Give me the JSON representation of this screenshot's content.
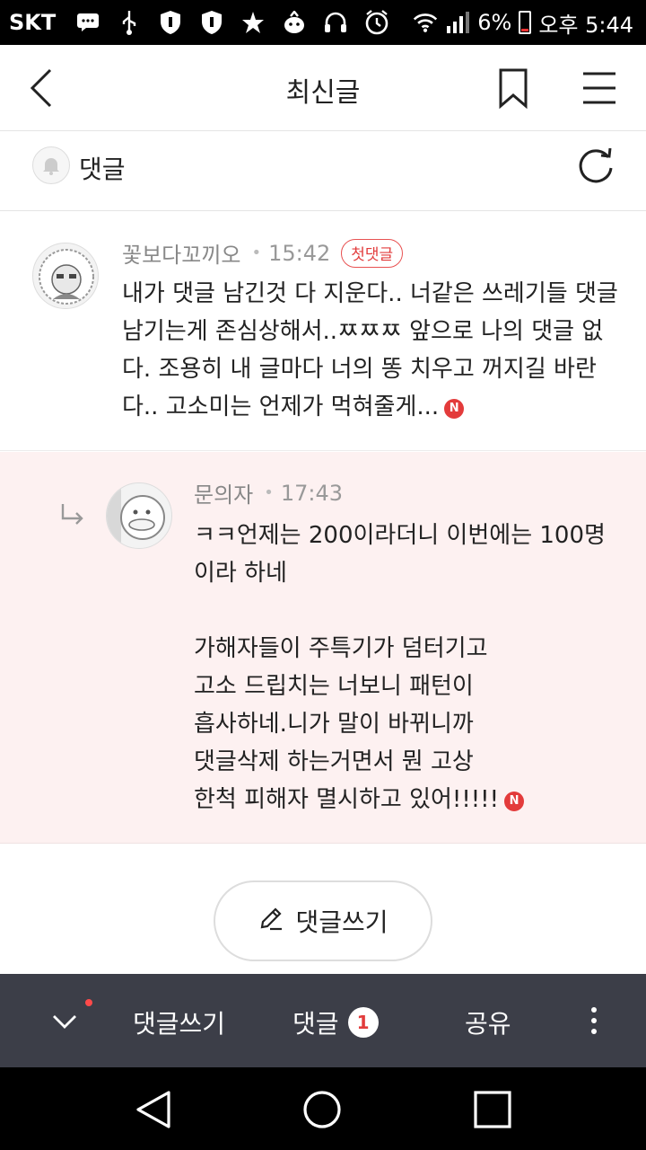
{
  "status_bar": {
    "carrier": "SKT",
    "battery": "6%",
    "time": "오후 5:44",
    "icons": [
      "message-icon",
      "usb-icon",
      "shield-icon",
      "shield-icon",
      "star-icon",
      "mascot-icon",
      "headset-icon",
      "alarm-icon",
      "wifi-icon",
      "signal-icon"
    ]
  },
  "header": {
    "title": "최신글",
    "icons": [
      "back-icon",
      "bookmark-icon",
      "menu-icon"
    ]
  },
  "comments_header": {
    "label": "댓글",
    "icons": [
      "bell-icon",
      "refresh-icon"
    ]
  },
  "comments": [
    {
      "nickname": "꽃보다꼬끼오",
      "time": "15:42",
      "badge": "첫댓글",
      "text": "내가 댓글 남긴것 다 지운다.. 너같은 쓰레기들 댓글 남기는게 존심상해서..ㅉㅉㅉ 앞으로 나의 댓글 없다. 조용히 내 글마다 너의 똥 치우고 꺼지길 바란다.. 고소미는 언제가 먹혀줄게...",
      "new_badge": "N"
    }
  ],
  "reply": {
    "nickname": "문의자",
    "time": "17:43",
    "text": "ㅋㅋ언제는 200이라더니 이번에는 100명이라 하네\n\n가해자들이 주특기가 덤터기고\n고소 드립치는 너보니 패턴이\n흡사하네.니가 말이 바뀌니까\n댓글삭제 하는거면서 뭔 고상\n한척 피해자 멸시하고 있어!!!!!",
    "new_badge": "N"
  },
  "write_button": {
    "label": "댓글쓰기"
  },
  "toolbar": {
    "write_label": "댓글쓰기",
    "comments_label": "댓글",
    "comments_count": "1",
    "share_label": "공유"
  },
  "colors": {
    "accent_red": "#e23c3c",
    "reply_bg": "#fdf1f1",
    "toolbar_bg": "#3c3e48"
  }
}
